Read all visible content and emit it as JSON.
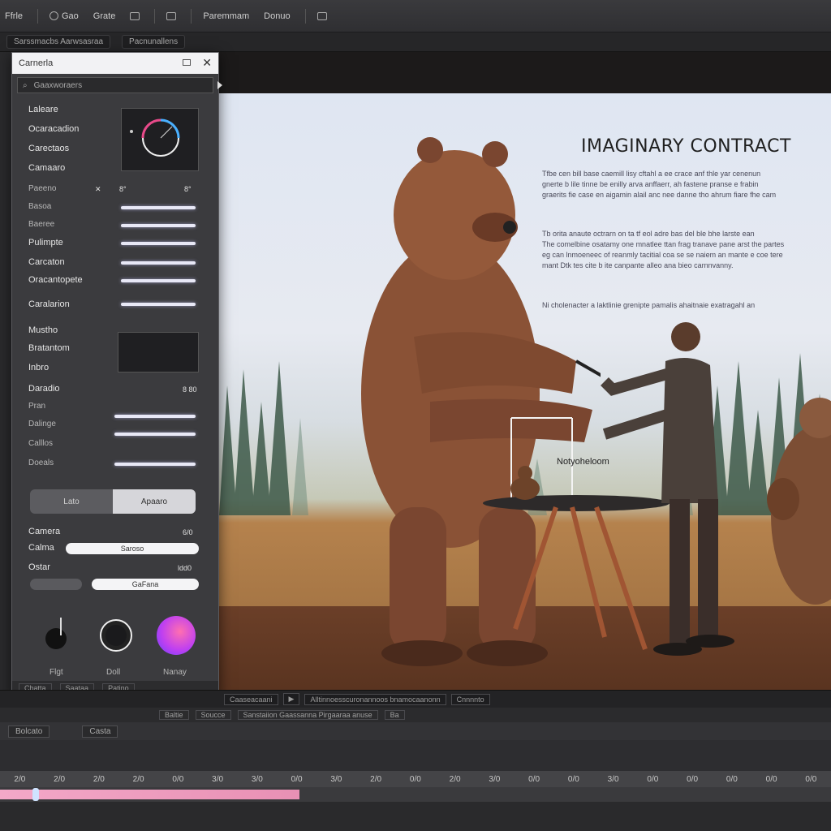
{
  "menubar": {
    "items": [
      "Ffrle",
      "Gao",
      "Grate",
      "Paremmam",
      "Donuo"
    ]
  },
  "subbar": {
    "items": [
      "Sarssmacbs Aarwsasraa",
      "Pacnunallens"
    ]
  },
  "panel": {
    "title": "Carnerla",
    "search": "Gaaxworaers",
    "rows": {
      "r1": "Laleare",
      "r2": "Ocaracadion",
      "r3": "Carectaos",
      "r4": "Camaaro",
      "r5": "Paeeno",
      "r6": "Basoa",
      "r7": "Baeree",
      "r8": "Pulimpte",
      "r9": "Carcaton",
      "r10": "Oracantopete",
      "r11": "Caralarion",
      "r12": "Mustho",
      "r13": "Bratantom",
      "r14": "Inbro",
      "r15": "Daradio",
      "r16": "Pran",
      "r17": "Dalinge",
      "r18": "Calllos",
      "r19": "Doeals",
      "r20": "Camera",
      "r21": "Calma",
      "r22": "Ostar"
    },
    "values": {
      "v1": "8°",
      "v2": "8°",
      "v3": "8°",
      "v4": "8 80",
      "v5": "6/0",
      "v6": "ldd0",
      "f1": "Saroso",
      "f2": "GaFana",
      "f3": "8 80"
    },
    "seg": {
      "left": "Lato",
      "right": "Apaaro"
    },
    "swatches": {
      "s1": "Flgt",
      "s2": "Doll",
      "s3": "Nanay"
    },
    "footer": [
      "Cbatta",
      "Saataa",
      "Patino"
    ]
  },
  "scene": {
    "heading": "IMAGINARY CONTRACT",
    "para1": [
      "Tfbe cen bill base caemill lisy cftahl a ee crace anf thle yar cenenun",
      "gnerte b lile tinne be enilly arva anffaerr, ah fastene pranse e frabin",
      "graerits fie case en aigamin alail anc nee danne tho ahrum fiare fhe cam"
    ],
    "para2": [
      "Tb orita anaute octrarn on ta tf eol adre bas del ble bhe larste ean",
      "The comelbine osatamy one mnatlee ttan frag tranave pane arst the partes",
      "eg can lnmoeneec of reanmly tacitial coa se se naiem an mante e coe tere",
      "mant Dtk tes cite b ite canpante alleo ana bieo carnnvanny."
    ],
    "para3": "Ni cholenacter a laktlinie grenipte pamalis ahaitnaie exatragahl an",
    "sign": "Notyoheloom",
    "colors": {
      "sky": "#e2e8f2",
      "field": "#b07c4a",
      "floor": "#5f3722",
      "bear": "#8a5236"
    }
  },
  "transport": {
    "items": [
      "Caaseacaani",
      "Alltinnoesscuronannoos bnamocaanonn",
      "Cnnnnto"
    ]
  },
  "row2": {
    "items": [
      "Baltie",
      "Soucce",
      "Sanstaiion Gaassanna Pirgaaraa anuse",
      "Ba"
    ]
  },
  "row3": {
    "items": [
      "Bolcato",
      "Casta"
    ]
  },
  "ruler": {
    "ticks": [
      "2/0",
      "2/0",
      "2/0",
      "2/0",
      "0/0",
      "3/0",
      "3/0",
      "0/0",
      "3/0",
      "2/0",
      "0/0",
      "2/0",
      "3/0",
      "0/0",
      "0/0",
      "3/0",
      "0/0",
      "0/0",
      "0/0",
      "0/0",
      "0/0"
    ]
  },
  "timeline": {
    "progress": 0.36
  }
}
